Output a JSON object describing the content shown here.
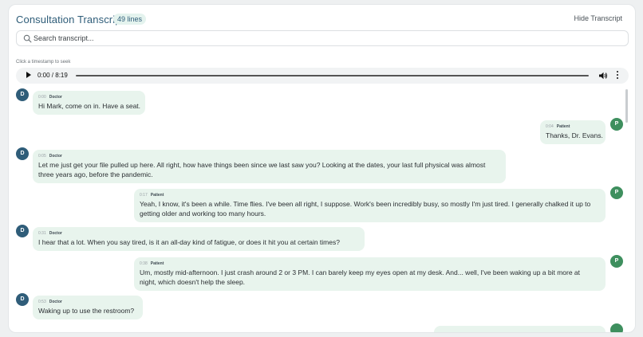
{
  "header": {
    "title": "Consultation Transcript",
    "line_count": "49 lines",
    "hide_label": "Hide Transcript"
  },
  "search": {
    "placeholder": "Search transcript..."
  },
  "player": {
    "hint": "Click a timestamp to seek",
    "time": "0:00 / 8:19"
  },
  "messages": [
    {
      "speaker": "Doctor",
      "initial": "D",
      "time": "0:00",
      "lines": [
        "Hi Mark, come on in. Have a seat."
      ]
    },
    {
      "speaker": "Patient",
      "initial": "P",
      "time": "0:04",
      "lines": [
        "Thanks, Dr. Evans."
      ]
    },
    {
      "speaker": "Doctor",
      "initial": "D",
      "time": "0:05",
      "lines": [
        "Let me just get your file pulled up here. All right, how have things been since we last saw you? Looking at the dates, your last full physical was almost",
        "three years ago, before the pandemic."
      ]
    },
    {
      "speaker": "Patient",
      "initial": "P",
      "time": "0:17",
      "lines": [
        "Yeah, I know, it's been a while. Time flies. I've been all right, I suppose. Work's been incredibly busy, so mostly I'm just tired. I generally chalked it up to",
        "getting older and working too many hours."
      ]
    },
    {
      "speaker": "Doctor",
      "initial": "D",
      "time": "0:31",
      "lines": [
        "I hear that a lot. When you say tired, is it an all-day kind of fatigue, or does it hit you at certain times?"
      ]
    },
    {
      "speaker": "Patient",
      "initial": "P",
      "time": "0:38",
      "lines": [
        "Um, mostly mid-afternoon. I just crash around 2 or 3 PM. I can barely keep my eyes open at my desk. And... well, I've been waking up a bit more at",
        "night, which doesn't help the sleep."
      ]
    },
    {
      "speaker": "Doctor",
      "initial": "D",
      "time": "0:53",
      "lines": [
        "Waking up to use the restroom?"
      ]
    }
  ],
  "colors": {
    "accent": "#2f5d79",
    "doctor_avatar": "#2f5d79",
    "patient_avatar": "#3e8f5e",
    "bubble": "#e8f4ed",
    "badge_bg": "#e4f3ee"
  },
  "icons": {
    "search": "search-icon",
    "play": "play-icon",
    "volume": "volume-icon",
    "menu": "more-vertical-icon"
  }
}
